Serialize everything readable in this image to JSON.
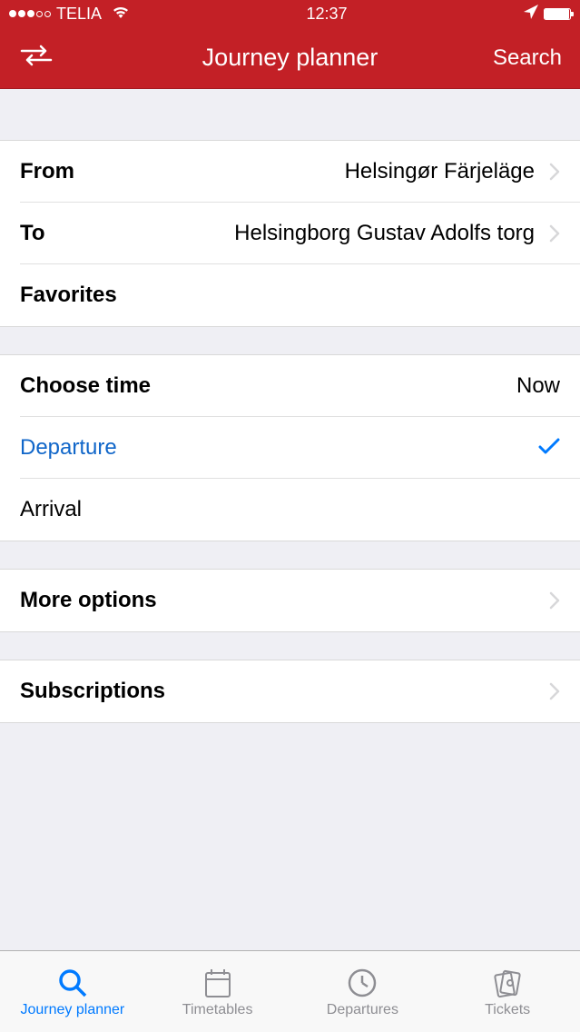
{
  "status_bar": {
    "carrier": "TELIA",
    "time": "12:37"
  },
  "nav": {
    "title": "Journey planner",
    "right_action": "Search"
  },
  "route": {
    "from_label": "From",
    "from_value": "Helsingør Färjeläge",
    "to_label": "To",
    "to_value": "Helsingborg Gustav Adolfs torg",
    "favorites_label": "Favorites"
  },
  "time": {
    "choose_label": "Choose time",
    "choose_value": "Now",
    "departure_label": "Departure",
    "arrival_label": "Arrival"
  },
  "more_options": {
    "label": "More options"
  },
  "subscriptions": {
    "label": "Subscriptions"
  },
  "tabs": {
    "journey_planner": "Journey planner",
    "timetables": "Timetables",
    "departures": "Departures",
    "tickets": "Tickets"
  }
}
